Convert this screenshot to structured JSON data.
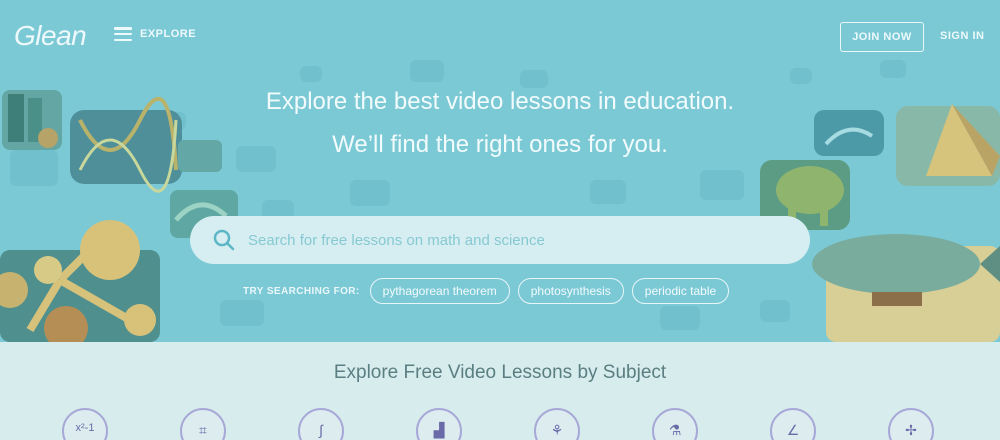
{
  "nav": {
    "logo": "Glean",
    "explore_label": "EXPLORE",
    "join_label": "JOIN NOW",
    "signin_label": "SIGN IN"
  },
  "hero": {
    "headline_1": "Explore the best video lessons in education.",
    "headline_2": "We’ll find the right ones for you.",
    "search_placeholder": "Search for free lessons on math and science",
    "try_label": "TRY SEARCHING FOR:",
    "suggestions": [
      "pythagorean theorem",
      "photosynthesis",
      "periodic table"
    ]
  },
  "subjects": {
    "title": "Explore Free Video Lessons by Subject",
    "first_icon_text": "x²-1",
    "icons": [
      "algebra-icon",
      "geometry-icon",
      "calculus-icon",
      "statistics-icon",
      "biology-icon",
      "chemistry-icon",
      "physics-icon",
      "engineering-icon"
    ]
  },
  "colors": {
    "hero_bg": "#7cc9d6",
    "subject_bg": "#d7ecec",
    "icon_ring": "#a8a8d8"
  }
}
